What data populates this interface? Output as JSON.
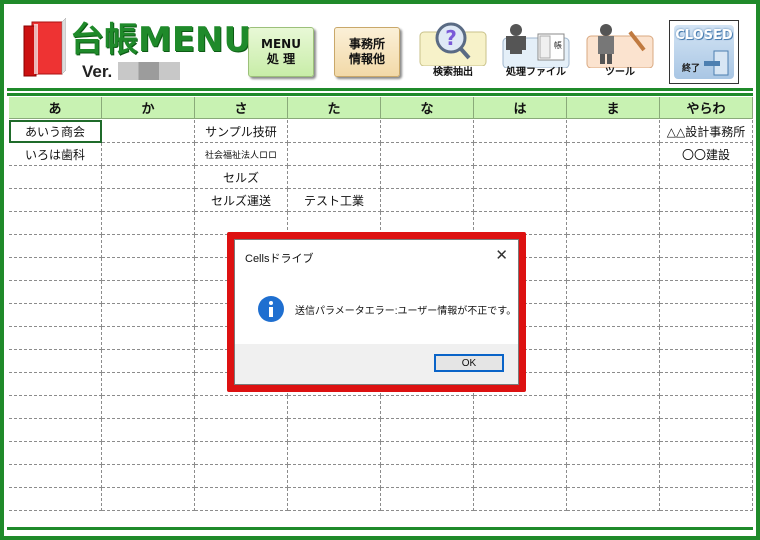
{
  "header": {
    "title": "台帳MENU",
    "version_label": "Ver.",
    "buttons": {
      "menu": [
        "MENU",
        "処 理"
      ],
      "jimu": [
        "事務所",
        "情報他"
      ],
      "search_caption": "検索抽出",
      "files_caption": "処理ファイル",
      "files_tag": "帳",
      "tools_caption": "ツール",
      "closed_word": "CLOSED",
      "closed_sub": "終了"
    }
  },
  "grid": {
    "columns": [
      "あ",
      "か",
      "さ",
      "た",
      "な",
      "は",
      "ま",
      "やらわ"
    ],
    "rows": [
      [
        "あいう商会",
        "",
        "サンプル技研",
        "",
        "",
        "",
        "",
        "△△設計事務所"
      ],
      [
        "いろは歯科",
        "",
        "社会福祉法人ロロ",
        "",
        "",
        "",
        "",
        "〇〇建設"
      ],
      [
        "",
        "",
        "セルズ",
        "",
        "",
        "",
        "",
        ""
      ],
      [
        "",
        "",
        "セルズ運送",
        "テスト工業",
        "",
        "",
        "",
        ""
      ]
    ],
    "empty_rows": 13,
    "selected_cell": "あいう商会"
  },
  "dialog": {
    "title": "Cellsドライブ",
    "close_glyph": "✕",
    "message": "送信パラメータエラー:ユーザー情報が不正です。",
    "ok_label": "OK",
    "icon": "info-icon"
  },
  "colors": {
    "frame_green": "#1f8a2a",
    "header_row": "#c8f2b2",
    "dialog_border": "#dd1111",
    "ok_focus": "#0a64c8"
  }
}
